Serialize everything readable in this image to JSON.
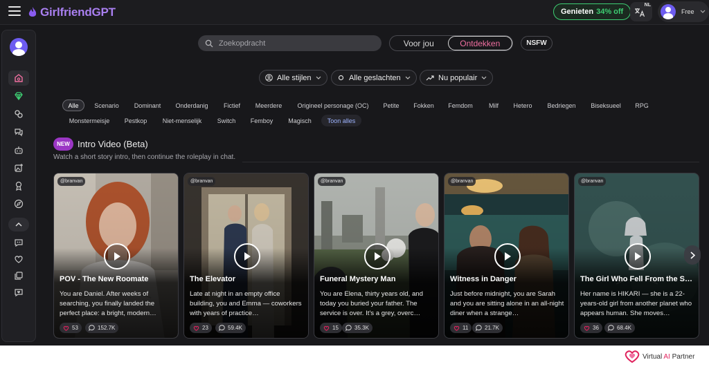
{
  "header": {
    "logo_text": "GirlfriendGPT",
    "promo_label": "Genieten",
    "promo_discount": "34% off",
    "language_code": "NL",
    "user_tier": "Free"
  },
  "sidebar": {
    "items": [
      {
        "icon": "home-icon",
        "active": true
      },
      {
        "icon": "diamond-icon",
        "accent": "#3ecf73"
      },
      {
        "icon": "link-icon"
      },
      {
        "icon": "chat-icon"
      },
      {
        "icon": "robot-icon"
      },
      {
        "icon": "image-add-icon"
      },
      {
        "icon": "award-icon"
      },
      {
        "icon": "compass-icon"
      },
      {
        "icon": "collapse-icon"
      },
      {
        "icon": "bot-chat-icon"
      },
      {
        "icon": "heart-icon"
      },
      {
        "icon": "gallery-icon"
      },
      {
        "icon": "heart-chat-icon"
      }
    ]
  },
  "search": {
    "placeholder": "Zoekopdracht"
  },
  "view_toggle": {
    "options": [
      "Voor jou",
      "Ontdekken"
    ],
    "selected": "Ontdekken"
  },
  "nsfw_label": "NSFW",
  "filters": {
    "style": "Alle stijlen",
    "gender": "Alle geslachten",
    "sort": "Nu populair"
  },
  "tags": {
    "row1": [
      "Alle",
      "Scenario",
      "Dominant",
      "Onderdanig",
      "Fictief",
      "Meerdere",
      "Origineel personage (OC)",
      "Petite",
      "Fokken",
      "Femdom",
      "Milf",
      "Hetero",
      "Bedriegen",
      "Biseksueel",
      "RPG"
    ],
    "row2": [
      "Monstermeisje",
      "Pestkop",
      "Niet-menselijk",
      "Switch",
      "Femboy",
      "Magisch"
    ],
    "show_all": "Toon alles",
    "selected": "Alle"
  },
  "section": {
    "badge": "NEW",
    "title": "Intro Video (Beta)",
    "subtitle": "Watch a short story intro, then continue the roleplay in chat."
  },
  "cards": [
    {
      "creator": "@branvan",
      "title": "POV - The New Roomate",
      "description": "You are Daniel. After weeks of searching, you finally landed the perfect place: a bright, modern…",
      "likes": "53",
      "chats": "152.7K"
    },
    {
      "creator": "@branvan",
      "title": "The Elevator",
      "description": "Late at night in an empty office building, you and Emma — coworkers with years of practice…",
      "likes": "23",
      "chats": "59.4K"
    },
    {
      "creator": "@branvan",
      "title": "Funeral Mystery Man",
      "description": "You are Elena, thirty years old, and today you buried your father. The service is over. It's a grey, overc…",
      "likes": "15",
      "chats": "35.3K"
    },
    {
      "creator": "@branvan",
      "title": "Witness in Danger",
      "description": "Just before midnight, you are Sarah and you are sitting alone in an all-night diner when a strange…",
      "likes": "11",
      "chats": "21.7K"
    },
    {
      "creator": "@branvan",
      "title": "The Girl Who Fell From the S…",
      "description": "Her name is HIKARI — she is a 22-years-old girl from another planet who appears human. She moves…",
      "likes": "36",
      "chats": "68.4K"
    }
  ],
  "watermark": {
    "text_before": "Virtual ",
    "text_ai": "AI",
    "text_after": " Partner"
  },
  "colors": {
    "background": "#18181b",
    "accent_purple": "#a97ff0",
    "promo_green": "#3ecf73",
    "selected_pink": "#f06fa0",
    "new_badge": "#9b36c4",
    "like_heart": "#e0245e"
  }
}
